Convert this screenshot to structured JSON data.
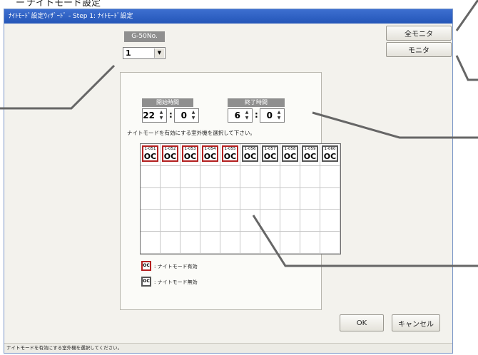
{
  "page_heading": {
    "prefix": "ー",
    "text": "ナイトモード設定"
  },
  "window": {
    "title": "ﾅｲﾄﾓｰﾄﾞ設定ｳｨｻﾞｰﾄﾞ - Step 1: ﾅｲﾄﾓｰﾄﾞ設定"
  },
  "g50": {
    "label": "G-50No.",
    "value": "1"
  },
  "buttons": {
    "all_monitor": "全モニタ",
    "monitor": "モニタ",
    "ok": "OK",
    "cancel": "キャンセル"
  },
  "times": {
    "start_label": "開始時間",
    "start_hour": "22",
    "start_min": "0",
    "end_label": "終了時間",
    "end_hour": "6",
    "end_min": "0",
    "colon": ":"
  },
  "instruction": "ナイトモードを有効にする室外機を選択して下さい。",
  "units": [
    {
      "num": "1-051",
      "label": "OC",
      "enabled": true
    },
    {
      "num": "1-052",
      "label": "OC",
      "enabled": true
    },
    {
      "num": "1-053",
      "label": "OC",
      "enabled": true
    },
    {
      "num": "1-054",
      "label": "OC",
      "enabled": true
    },
    {
      "num": "1-055",
      "label": "OC",
      "enabled": true
    },
    {
      "num": "1-056",
      "label": "OC",
      "enabled": false
    },
    {
      "num": "1-057",
      "label": "OC",
      "enabled": false
    },
    {
      "num": "1-058",
      "label": "OC",
      "enabled": false
    },
    {
      "num": "1-059",
      "label": "OC",
      "enabled": false
    },
    {
      "num": "1-060",
      "label": "OC",
      "enabled": false
    }
  ],
  "legend": {
    "icon_label": "OC",
    "enabled": ": ナイトモード有効",
    "disabled": ": ナイトモード無効"
  },
  "status": "ナイトモードを有効にする室外機を選択してください。",
  "colors": {
    "titlebar": "#2456b8",
    "enabled_border": "#b32020",
    "disabled_border": "#555555"
  }
}
